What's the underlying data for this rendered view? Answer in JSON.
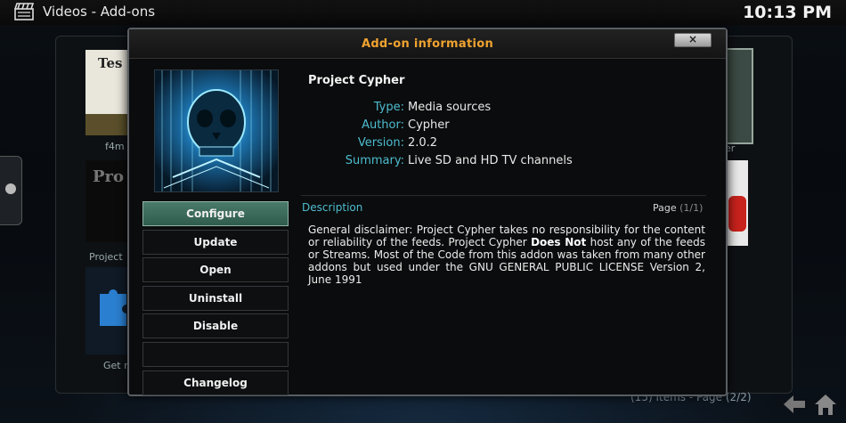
{
  "header": {
    "title": "Videos  - Add-ons",
    "clock": "10:13 PM"
  },
  "background": {
    "thumb1_text": "Tes",
    "thumb2_text": "Pro",
    "label_top_left": "f4m",
    "label_mid_left": "Project",
    "label_bottom_left": "Get m",
    "label_right": "er",
    "items_count": "(15) Items - Page (2/2)"
  },
  "dialog": {
    "title": "Add-on information",
    "close_label": "×",
    "addon_name": "Project Cypher",
    "meta": [
      {
        "key": "Type:",
        "value": "Media sources"
      },
      {
        "key": "Author:",
        "value": "Cypher"
      },
      {
        "key": "Version:",
        "value": "2.0.2"
      },
      {
        "key": "Summary:",
        "value": "Live SD and HD TV channels"
      }
    ],
    "description_label": "Description",
    "page_label": "Page",
    "page_value": "(1/1)",
    "description": {
      "part1": "General disclaimer: Project Cypher takes no responsibility for the content or reliability of the feeds. Project Cypher ",
      "bold": "Does Not",
      "part2": " host any of the feeds or Streams. Most of the Code from this addon was taken from many other addons but used under the GNU GENERAL PUBLIC LICENSE Version 2, June 1991"
    },
    "buttons": [
      {
        "label": "Configure",
        "focused": true
      },
      {
        "label": "Update"
      },
      {
        "label": "Open"
      },
      {
        "label": "Uninstall"
      },
      {
        "label": "Disable"
      },
      {
        "label": ""
      },
      {
        "label": "Changelog"
      }
    ]
  },
  "colors": {
    "accent_orange": "#f0a330",
    "label_cyan": "#4dbccf",
    "focus_green": "#3f6e5e"
  },
  "icons": {
    "header": "clapperboard-icon",
    "back": "back-arrow-icon",
    "home": "home-icon"
  }
}
